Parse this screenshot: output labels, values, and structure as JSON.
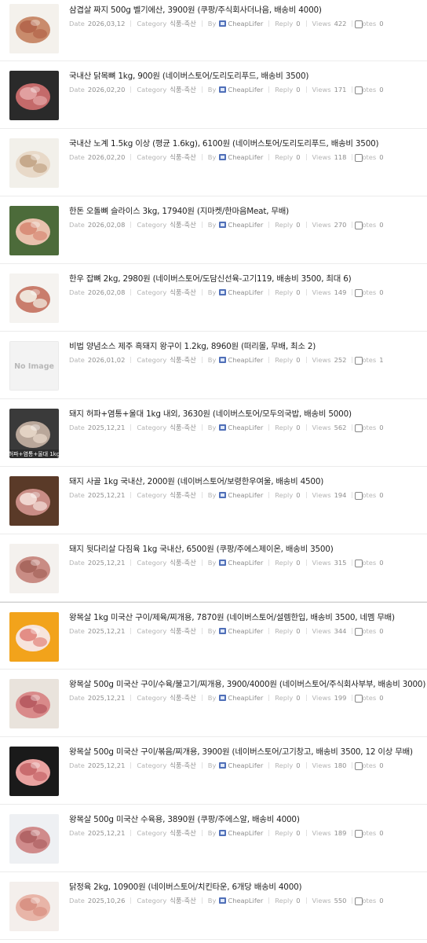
{
  "labels": {
    "date": "Date",
    "category": "Category",
    "by": "By",
    "reply": "Reply",
    "views": "Views",
    "votes": "Votes",
    "no_image": "No Image"
  },
  "items": [
    {
      "title": "삼겹살 짜지 500g 벨기에산, 3900원 (쿠팡/주식회사더나음, 배송비 4000)",
      "date": "2026,03,12",
      "category": "식품-축산",
      "author": "CheapLifer",
      "reply": "0",
      "views": "422",
      "votes": "0",
      "thumb_icon": "raw-pork-pieces-icon",
      "thumb_colors": [
        "#f4f1ec",
        "#c98b6c",
        "#b5684e"
      ]
    },
    {
      "title": "국내산 닭목뼈 1kg, 900원 (네이버스토어/도리도리푸드, 배송비 3500)",
      "date": "2026,02,20",
      "category": "식품-축산",
      "author": "CheapLifer",
      "reply": "0",
      "views": "171",
      "votes": "0",
      "thumb_icon": "chicken-neck-icon",
      "thumb_colors": [
        "#2a2a2a",
        "#c46a6a",
        "#e1a0a0"
      ]
    },
    {
      "title": "국내산 노계 1.5kg 이상 (평균 1.6kg), 6100원 (네이버스토어/도리도리푸드, 배송비 3500)",
      "date": "2026,02,20",
      "category": "식품-축산",
      "author": "CheapLifer",
      "reply": "0",
      "views": "118",
      "votes": "0",
      "thumb_icon": "whole-chicken-icon",
      "thumb_colors": [
        "#f2f0ea",
        "#e8d9c8",
        "#c6a98c"
      ]
    },
    {
      "title": "한돈 오돌뼈 슬라이스 3kg, 17940원 (지마켓/한마음Meat, 무배)",
      "date": "2026,02,08",
      "category": "식품-축산",
      "author": "CheapLifer",
      "reply": "0",
      "views": "270",
      "votes": "0",
      "thumb_icon": "sliced-pork-plate-icon",
      "thumb_colors": [
        "#4c6b3a",
        "#e9c1ad",
        "#d98f7a"
      ]
    },
    {
      "title": "한우 잡뼈 2kg, 2980원 (네이버스토어/도담신선육-고기119, 배송비 3500, 최대 6)",
      "date": "2026,02,08",
      "category": "식품-축산",
      "author": "CheapLifer",
      "reply": "0",
      "views": "149",
      "votes": "0",
      "thumb_icon": "beef-bones-icon",
      "thumb_colors": [
        "#f5f3f0",
        "#c97d6c",
        "#efe3d8"
      ]
    },
    {
      "title": "비법 양념소스 제주 흑돼지 왕구이 1.2kg, 8960원 (떠리몰, 무배, 최소 2)",
      "date": "2026,01,02",
      "category": "식품-축산",
      "author": "CheapLifer",
      "reply": "0",
      "views": "252",
      "votes": "1",
      "thumb_icon": "no-image-icon",
      "thumb_colors": [
        "#f3f3f3",
        "#e2e2e2",
        "#c0c0c0"
      ]
    },
    {
      "title": "돼지 허파+염통+울대 1kg 내외, 3630원 (네이버스토어/모두의국밥, 배송비 5000)",
      "date": "2025,12,21",
      "category": "식품-축산",
      "author": "CheapLifer",
      "reply": "0",
      "views": "562",
      "votes": "0",
      "thumb_icon": "pork-offal-icon",
      "thumb_colors": [
        "#3a3a3a",
        "#b9a79a",
        "#e3d3c4"
      ],
      "thumb_text": "허파+염통+울대 1kg"
    },
    {
      "title": "돼지 사골 1kg 국내산, 2000원 (네이버스토어/보령한우여울, 배송비 4500)",
      "date": "2025,12,21",
      "category": "식품-축산",
      "author": "CheapLifer",
      "reply": "0",
      "views": "194",
      "votes": "0",
      "thumb_icon": "pork-bone-icon",
      "thumb_colors": [
        "#5a3a28",
        "#c98d86",
        "#f0d6d0"
      ]
    },
    {
      "title": "돼지 뒷다리살 다짐육 1kg 국내산, 6500원 (쿠팡/주에스제이온, 배송비 3500)",
      "date": "2025,12,21",
      "category": "식품-축산",
      "author": "CheapLifer",
      "reply": "0",
      "views": "315",
      "votes": "0",
      "thumb_icon": "minced-pork-icon",
      "thumb_colors": [
        "#f4f1ee",
        "#c98c84",
        "#a9685f"
      ]
    },
    {
      "title": "왕목살 1kg 미국산 구이/제육/찌개용, 7870원 (네이버스토어/설렘한입, 배송비 3500, 네멤 무배)",
      "date": "2025,12,21",
      "category": "식품-축산",
      "author": "CheapLifer",
      "reply": "0",
      "views": "344",
      "votes": "0",
      "thumb_icon": "pork-neck-slices-icon",
      "thumb_colors": [
        "#f2a31b",
        "#f7e4dc",
        "#e38e86"
      ]
    },
    {
      "title": "왕목살 500g 미국산 구이/수육/불고기/찌개용, 3900/4000원 (네이버스토어/주식회사부부, 배송비 3000)",
      "date": "2025,12,21",
      "category": "식품-축산",
      "author": "CheapLifer",
      "reply": "0",
      "views": "199",
      "votes": "0",
      "thumb_icon": "pork-neck-block-icon",
      "thumb_colors": [
        "#e9e3dc",
        "#d98a8a",
        "#b95d63"
      ]
    },
    {
      "title": "왕목살 500g 미국산 구이/볶음/찌개용, 3900원 (네이버스토어/고기창고, 배송비 3500, 12 이상 무배)",
      "date": "2025,12,21",
      "category": "식품-축산",
      "author": "CheapLifer",
      "reply": "0",
      "views": "180",
      "votes": "0",
      "thumb_icon": "pork-neck-sliced-icon",
      "thumb_colors": [
        "#1a1a1a",
        "#e9a2a0",
        "#c96c6e"
      ]
    },
    {
      "title": "왕목살 500g 미국산 수육용, 3890원 (쿠팡/주에스알, 배송비 4000)",
      "date": "2025,12,21",
      "category": "식품-축산",
      "author": "CheapLifer",
      "reply": "0",
      "views": "189",
      "votes": "0",
      "thumb_icon": "pork-neck-chunk-icon",
      "thumb_colors": [
        "#eef0f3",
        "#d08b8b",
        "#b26566"
      ]
    },
    {
      "title": "닭정육 2kg, 10900원 (네이버스토어/치킨타운, 6개당 배송비 4000)",
      "date": "2025,10,26",
      "category": "식품-축산",
      "author": "CheapLifer",
      "reply": "0",
      "views": "550",
      "votes": "0",
      "thumb_icon": "chicken-thigh-icon",
      "thumb_colors": [
        "#f4efec",
        "#e8b5a8",
        "#d99385"
      ]
    }
  ]
}
